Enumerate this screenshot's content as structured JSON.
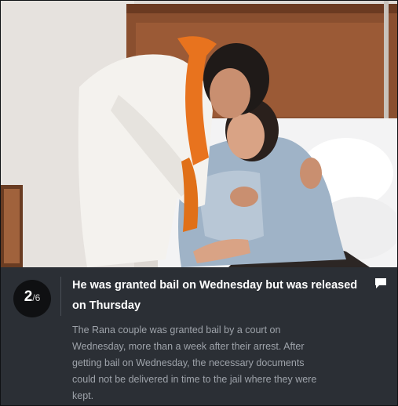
{
  "slide": {
    "current": "2",
    "separator": "/",
    "total": "6"
  },
  "caption": {
    "title": "He was granted bail on Wednesday but was released on Thursday",
    "body": "The Rana couple was granted bail by a court on Wednesday, more than a week after their arrest. After getting bail on Wednesday, the necessary documents could not be delivered in time to the jail where they were kept."
  },
  "icons": {
    "comment": "comment-icon"
  },
  "colors": {
    "caption_background": "#2b2f35",
    "counter_background": "#0f1012",
    "title_text": "#ffffff",
    "body_text": "#9ea3aa",
    "saffron_scarf": "#e8731e"
  }
}
